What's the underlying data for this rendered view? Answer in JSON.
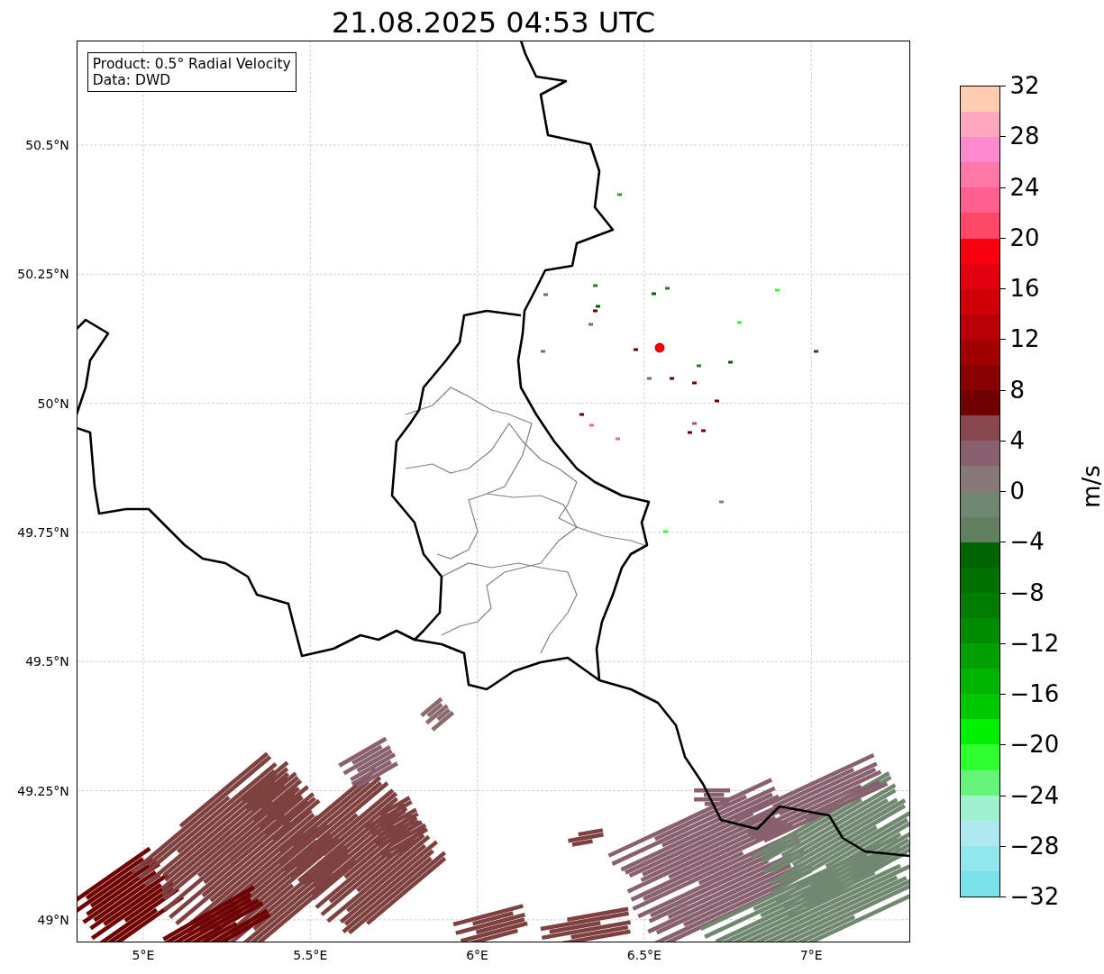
{
  "title": "21.08.2025 04:53 UTC",
  "info_box": [
    "Product: 0.5° Radial Velocity",
    "Data: DWD"
  ],
  "y_ticks": [
    "50.5°N",
    "50.25°N",
    "50°N",
    "49.75°N",
    "49.5°N",
    "49.25°N",
    "49°N"
  ],
  "x_ticks": [
    "5°E",
    "5.5°E",
    "6°E",
    "6.5°E",
    "7°E"
  ],
  "colorbar": {
    "label": "m/s",
    "ticks": [
      "32",
      "28",
      "24",
      "20",
      "16",
      "12",
      "8",
      "4",
      "0",
      "−4",
      "−8",
      "−12",
      "−16",
      "−20",
      "−24",
      "−28",
      "−32"
    ],
    "bands": [
      {
        "color": "#ffcdb0"
      },
      {
        "color": "#ffa8c0"
      },
      {
        "color": "#ff88d0"
      },
      {
        "color": "#ff78a8"
      },
      {
        "color": "#ff6090"
      },
      {
        "color": "#ff4868"
      },
      {
        "color": "#f80010"
      },
      {
        "color": "#e00010"
      },
      {
        "color": "#d00008"
      },
      {
        "color": "#b80008"
      },
      {
        "color": "#a00000"
      },
      {
        "color": "#880000"
      },
      {
        "color": "#700000"
      },
      {
        "color": "#884850"
      },
      {
        "color": "#886070"
      },
      {
        "color": "#887878"
      },
      {
        "color": "#708870"
      },
      {
        "color": "#608060"
      },
      {
        "color": "#006400"
      },
      {
        "color": "#007000"
      },
      {
        "color": "#007c00"
      },
      {
        "color": "#008c00"
      },
      {
        "color": "#00a000"
      },
      {
        "color": "#00b400"
      },
      {
        "color": "#00c800"
      },
      {
        "color": "#00f000"
      },
      {
        "color": "#30ff30"
      },
      {
        "color": "#66f57a"
      },
      {
        "color": "#a0f0d0"
      },
      {
        "color": "#b0e8f0"
      },
      {
        "color": "#90e8ec"
      },
      {
        "color": "#78e2e8"
      }
    ]
  }
}
